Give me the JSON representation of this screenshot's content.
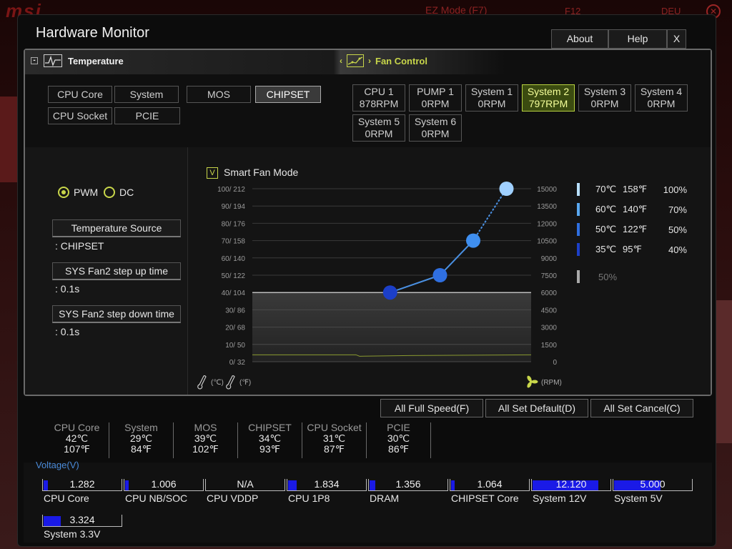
{
  "background": {
    "ez_mode": "EZ Mode (F7)",
    "f12": "F12",
    "lang": "DEU"
  },
  "window": {
    "title": "Hardware Monitor",
    "about": "About",
    "help": "Help",
    "close": "X"
  },
  "tabs": {
    "temperature": "Temperature",
    "fan_control": "Fan Control"
  },
  "sensors": [
    "CPU Core",
    "System",
    "MOS",
    "CHIPSET",
    "CPU Socket",
    "PCIE"
  ],
  "selected_sensor": "CHIPSET",
  "fans": [
    {
      "name": "CPU 1",
      "rpm": "878RPM"
    },
    {
      "name": "PUMP 1",
      "rpm": "0RPM"
    },
    {
      "name": "System 1",
      "rpm": "0RPM"
    },
    {
      "name": "System 2",
      "rpm": "797RPM"
    },
    {
      "name": "System 3",
      "rpm": "0RPM"
    },
    {
      "name": "System 4",
      "rpm": "0RPM"
    },
    {
      "name": "System 5",
      "rpm": "0RPM"
    },
    {
      "name": "System 6",
      "rpm": "0RPM"
    }
  ],
  "selected_fan": "System 2",
  "mode": {
    "pwm": "PWM",
    "dc": "DC",
    "selected": "PWM"
  },
  "temp_source": {
    "label": "Temperature Source",
    "value": ": CHIPSET"
  },
  "step_up": {
    "label": "SYS Fan2 step up time",
    "value": ": 0.1s"
  },
  "step_down": {
    "label": "SYS Fan2 step down time",
    "value": ": 0.1s"
  },
  "smart_fan": {
    "label": "Smart Fan Mode",
    "checked": true,
    "checkmark": "V"
  },
  "chart_data": {
    "type": "line",
    "left_ticks": [
      "100/ 212",
      "90/ 194",
      "80/ 176",
      "70/ 158",
      "60/ 140",
      "50/ 122",
      "40/ 104",
      "30/  86",
      "20/  68",
      "10/  50",
      "0/  32"
    ],
    "right_ticks": [
      "15000",
      "13500",
      "12000",
      "10500",
      "9000",
      "7500",
      "6000",
      "4500",
      "3000",
      "1500",
      "0"
    ],
    "ylim": [
      0,
      100
    ],
    "rpm_lim": [
      0,
      15000
    ],
    "curve_points": [
      {
        "temp_c": 35,
        "pct": 40
      },
      {
        "temp_c": 50,
        "pct": 50
      },
      {
        "temp_c": 60,
        "pct": 70
      },
      {
        "temp_c": 70,
        "pct": 100
      }
    ],
    "point_colors": [
      "#1c3fc8",
      "#2f6fe0",
      "#3f8ff0",
      "#9fd0ff"
    ],
    "threshold_pct": 40,
    "current_rpm_pct": 4,
    "xlabel_temp_c": "(℃)",
    "xlabel_temp_f": "(℉)",
    "xlabel_rpm": "(RPM)"
  },
  "legend": [
    {
      "c": "70℃",
      "f": "158℉",
      "pct": "100%",
      "color": "#b8e0ff"
    },
    {
      "c": "60℃",
      "f": "140℉",
      "pct": "70%",
      "color": "#5aa8f0"
    },
    {
      "c": "50℃",
      "f": "122℉",
      "pct": "50%",
      "color": "#2f6fe0"
    },
    {
      "c": "35℃",
      "f": "95℉",
      "pct": "40%",
      "color": "#1c3fc8"
    }
  ],
  "min_pct": "50%",
  "actions": {
    "full_speed": "All Full Speed(F)",
    "set_default": "All Set Default(D)",
    "set_cancel": "All Set Cancel(C)"
  },
  "readings": [
    {
      "name": "CPU Core",
      "c": "42℃",
      "f": "107℉"
    },
    {
      "name": "System",
      "c": "29℃",
      "f": "84℉"
    },
    {
      "name": "MOS",
      "c": "39℃",
      "f": "102℉"
    },
    {
      "name": "CHIPSET",
      "c": "34℃",
      "f": "93℉"
    },
    {
      "name": "CPU Socket",
      "c": "31℃",
      "f": "87℉"
    },
    {
      "name": "PCIE",
      "c": "30℃",
      "f": "86℉"
    }
  ],
  "voltage_title": "Voltage(V)",
  "voltages": [
    {
      "name": "CPU Core",
      "value": "1.282",
      "fill": 0.06
    },
    {
      "name": "CPU NB/SOC",
      "value": "1.006",
      "fill": 0.05
    },
    {
      "name": "CPU VDDP",
      "value": "N/A",
      "fill": 0
    },
    {
      "name": "CPU 1P8",
      "value": "1.834",
      "fill": 0.11
    },
    {
      "name": "DRAM",
      "value": "1.356",
      "fill": 0.07
    },
    {
      "name": "CHIPSET Core",
      "value": "1.064",
      "fill": 0.05
    },
    {
      "name": "System 12V",
      "value": "12.120",
      "fill": 0.85
    },
    {
      "name": "System 5V",
      "value": "5.000",
      "fill": 0.6
    },
    {
      "name": "System 3.3V",
      "value": "3.324",
      "fill": 0.22
    }
  ]
}
